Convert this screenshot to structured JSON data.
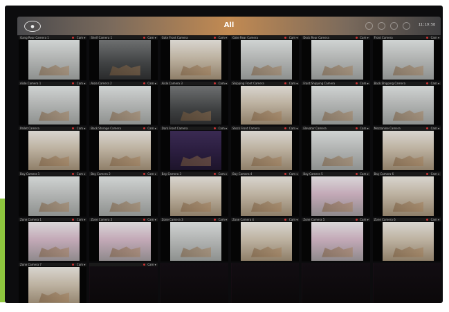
{
  "header": {
    "title": "All",
    "clock": "11:19:58"
  },
  "tiles": [
    {
      "label": "Gang Rear Camera 1",
      "label_r": "Cam ▾",
      "style": "default"
    },
    {
      "label": "Shelf Camera 1",
      "label_r": "Cam ▾",
      "style": "dark"
    },
    {
      "label": "Gate Front Camera",
      "label_r": "Cam ▾",
      "style": "warm"
    },
    {
      "label": "Gate Rear Camera",
      "label_r": "Cam ▾",
      "style": "default"
    },
    {
      "label": "Dock Rear Camera",
      "label_r": "Cam ▾",
      "style": "default"
    },
    {
      "label": "Front Camera",
      "label_r": "Cam ▾",
      "style": "default"
    },
    {
      "label": "Aisle Camera 1",
      "label_r": "Cam ▾",
      "style": "default"
    },
    {
      "label": "Aisle Camera 2",
      "label_r": "Cam ▾",
      "style": "default"
    },
    {
      "label": "Aisle Camera 3",
      "label_r": "Cam ▾",
      "style": "dark"
    },
    {
      "label": "Shipping Front Camera",
      "label_r": "Cam ▾",
      "style": "warm"
    },
    {
      "label": "Front Shipping Camera",
      "label_r": "Cam ▾",
      "style": "default"
    },
    {
      "label": "Back Shipping Camera",
      "label_r": "Cam ▾",
      "style": "default"
    },
    {
      "label": "Pallet Camera",
      "label_r": "Cam ▾",
      "style": "warm"
    },
    {
      "label": "Back Storage Camera",
      "label_r": "Cam ▾",
      "style": "warm"
    },
    {
      "label": "Dark Front Camera",
      "label_r": "Cam ▾",
      "style": "purple"
    },
    {
      "label": "Stock Front Camera",
      "label_r": "Cam ▾",
      "style": "warm"
    },
    {
      "label": "Elevator Camera",
      "label_r": "Cam ▾",
      "style": "default"
    },
    {
      "label": "Mezzanine Camera",
      "label_r": "Cam ▾",
      "style": "warm"
    },
    {
      "label": "Bay Camera 1",
      "label_r": "Cam ▾",
      "style": "default"
    },
    {
      "label": "Bay Camera 2",
      "label_r": "Cam ▾",
      "style": "default"
    },
    {
      "label": "Bay Camera 3",
      "label_r": "Cam ▾",
      "style": "warm"
    },
    {
      "label": "Bay Camera 4",
      "label_r": "Cam ▾",
      "style": "warm"
    },
    {
      "label": "Bay Camera 5",
      "label_r": "Cam ▾",
      "style": "pink"
    },
    {
      "label": "Bay Camera 6",
      "label_r": "Cam ▾",
      "style": "warm"
    },
    {
      "label": "Zone Camera 1",
      "label_r": "Cam ▾",
      "style": "pink"
    },
    {
      "label": "Zone Camera 2",
      "label_r": "Cam ▾",
      "style": "pink"
    },
    {
      "label": "Zone Camera 3",
      "label_r": "Cam ▾",
      "style": "default"
    },
    {
      "label": "Zone Camera 4",
      "label_r": "Cam ▾",
      "style": "warm"
    },
    {
      "label": "Zone Camera 5",
      "label_r": "Cam ▾",
      "style": "pink"
    },
    {
      "label": "Zone Camera 6",
      "label_r": "Cam ▾",
      "style": "warm"
    },
    {
      "label": "Zone Camera 7",
      "label_r": "Cam ▾",
      "style": "warm"
    },
    {
      "label": "",
      "label_r": "Cam ▾",
      "style": "empty"
    },
    {
      "label": "",
      "label_r": "",
      "style": "empty"
    },
    {
      "label": "",
      "label_r": "",
      "style": "empty"
    },
    {
      "label": "",
      "label_r": "",
      "style": "empty"
    },
    {
      "label": "",
      "label_r": "",
      "style": "empty"
    }
  ],
  "colors": {
    "accent_strip": "#8ec63f",
    "titlebar_center": "#c28a52",
    "device_bg": "#0c0c0e"
  },
  "icons": [
    "logo-icon",
    "record-icon",
    "settings-icon",
    "layout-icon",
    "fullscreen-icon"
  ]
}
